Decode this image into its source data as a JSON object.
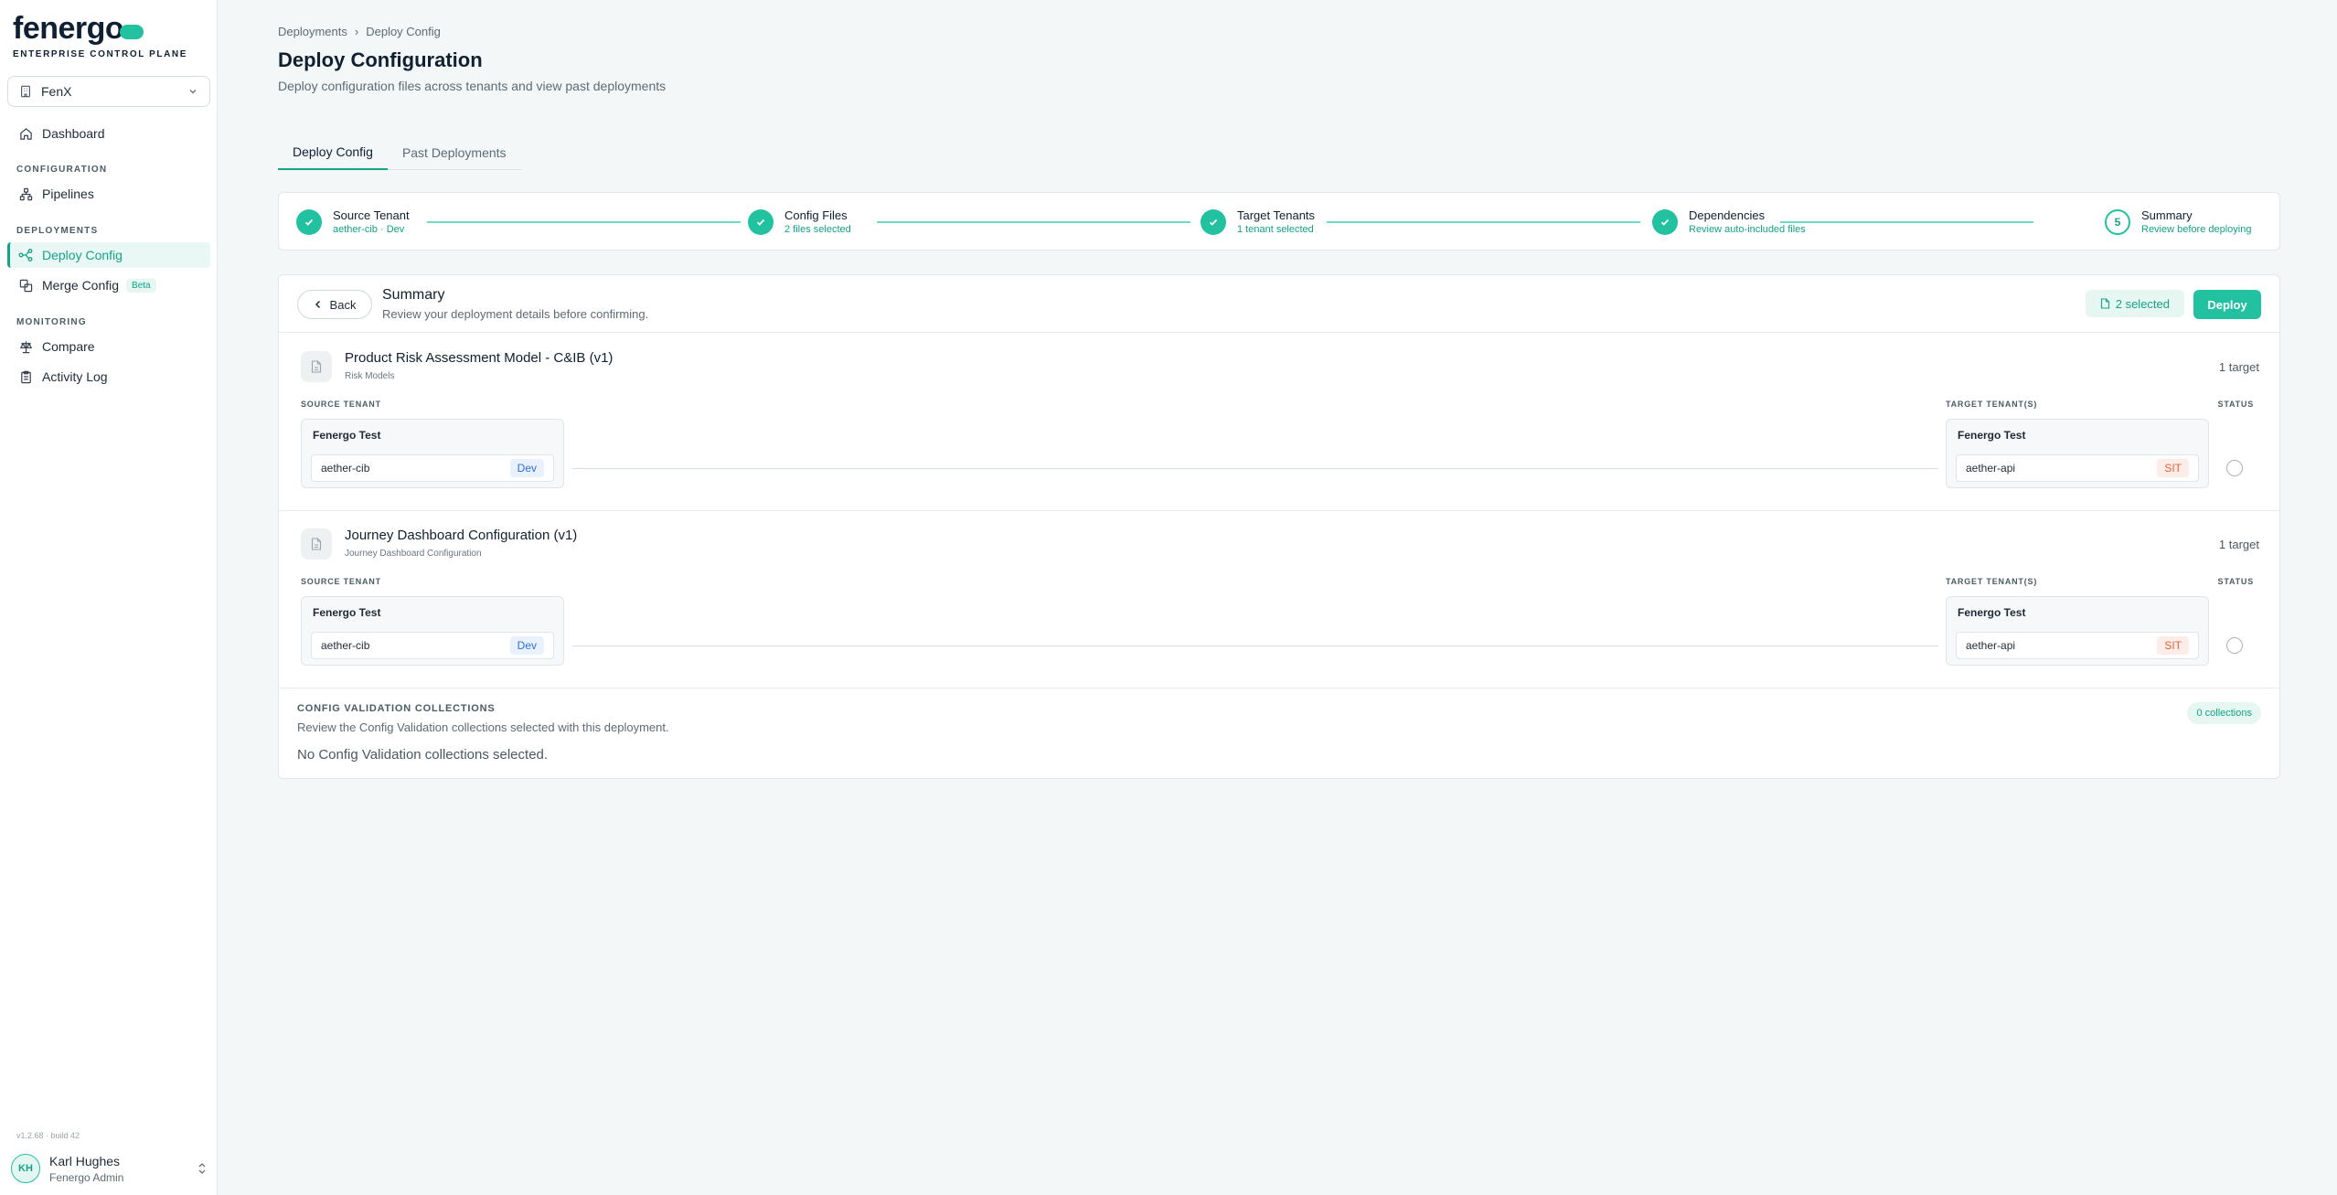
{
  "brand": {
    "logo": "fenergo",
    "tagline": "ENTERPRISE CONTROL PLANE"
  },
  "tenant_switcher": {
    "value": "FenX"
  },
  "nav": {
    "dashboard": "Dashboard",
    "section_configuration": "CONFIGURATION",
    "pipelines": "Pipelines",
    "section_deployments": "DEPLOYMENTS",
    "deploy_config": "Deploy Config",
    "merge_config": "Merge Config",
    "merge_badge": "Beta",
    "section_monitoring": "MONITORING",
    "compare": "Compare",
    "activity_log": "Activity Log"
  },
  "version": "v1.2.68 · build 42",
  "user": {
    "initials": "KH",
    "name": "Karl Hughes",
    "role": "Fenergo Admin"
  },
  "breadcrumb": {
    "root": "Deployments",
    "separator": "›",
    "current": "Deploy Config"
  },
  "page": {
    "title": "Deploy Configuration",
    "subtitle": "Deploy configuration files across tenants and view past deployments"
  },
  "tabs": [
    "Deploy Config",
    "Past Deployments"
  ],
  "steps": [
    {
      "title": "Source Tenant",
      "sub": "aether-cib · Dev",
      "state": "done"
    },
    {
      "title": "Config Files",
      "sub": "2 files selected",
      "state": "done"
    },
    {
      "title": "Target Tenants",
      "sub": "1 tenant selected",
      "state": "done"
    },
    {
      "title": "Dependencies",
      "sub": "Review auto-included files",
      "state": "done"
    },
    {
      "title": "Summary",
      "sub": "Review before deploying",
      "state": "current",
      "number": "5"
    }
  ],
  "summary": {
    "back_label": "Back",
    "title": "Summary",
    "subtitle": "Review your deployment details before confirming.",
    "selected_label": "2 selected",
    "deploy_label": "Deploy",
    "source_col": "SOURCE TENANT",
    "target_col": "TARGET TENANT(S)",
    "status_col": "STATUS"
  },
  "items": [
    {
      "title": "Product Risk Assessment Model - C&IB (v1)",
      "category": "Risk Models",
      "count": "1 target",
      "source": {
        "org": "Fenergo Test",
        "tenant": "aether-cib",
        "env": "Dev"
      },
      "target": {
        "org": "Fenergo Test",
        "tenant": "aether-api",
        "env": "SIT"
      }
    },
    {
      "title": "Journey Dashboard Configuration (v1)",
      "category": "Journey Dashboard Configuration",
      "count": "1 target",
      "source": {
        "org": "Fenergo Test",
        "tenant": "aether-cib",
        "env": "Dev"
      },
      "target": {
        "org": "Fenergo Test",
        "tenant": "aether-api",
        "env": "SIT"
      }
    }
  ],
  "config_validation": {
    "title": "CONFIG VALIDATION COLLECTIONS",
    "subtitle": "Review the Config Validation collections selected with this deployment.",
    "empty": "No Config Validation collections selected.",
    "badge": "0 collections"
  },
  "colors": {
    "accent": "#22c1a0",
    "accent_dark": "#13a386",
    "dev": "#2f6fe0",
    "sit": "#e0663f"
  }
}
